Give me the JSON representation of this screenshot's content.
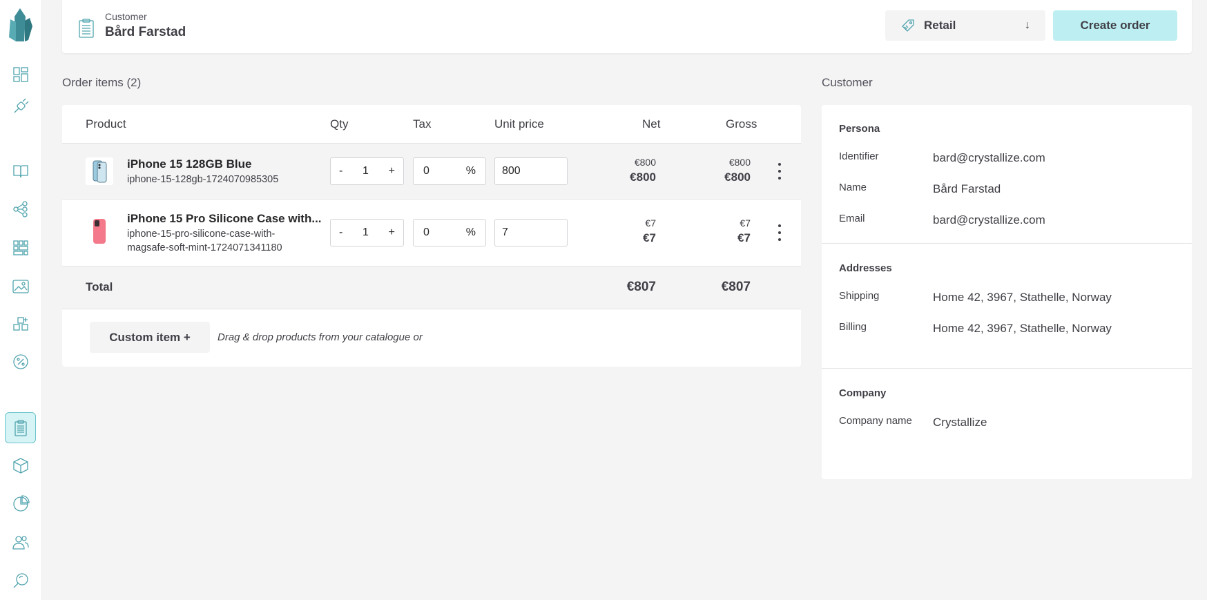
{
  "header": {
    "customer_label": "Customer",
    "customer_name": "Bård Farstad",
    "price_list": "Retail",
    "create_order": "Create order"
  },
  "order_items": {
    "title": "Order items (2)",
    "columns": [
      "Product",
      "Qty",
      "Tax",
      "Unit price",
      "Net",
      "Gross"
    ],
    "items": [
      {
        "name": "iPhone 15 128GB Blue",
        "sku": "iphone-15-128gb-1724070985305",
        "qty": "1",
        "tax": "0",
        "tax_unit": "%",
        "unit_price": "800",
        "net_small": "€800",
        "net_big": "€800",
        "gross_small": "€800",
        "gross_big": "€800"
      },
      {
        "name": "iPhone 15 Pro Silicone Case with...",
        "sku_line1": "iphone-15-pro-silicone-case-with-",
        "sku_line2": "magsafe-soft-mint-1724071341180",
        "qty": "1",
        "tax": "0",
        "tax_unit": "%",
        "unit_price": "7",
        "net_small": "€7",
        "net_big": "€7",
        "gross_small": "€7",
        "gross_big": "€7"
      }
    ],
    "total_label": "Total",
    "total_net": "€807",
    "total_gross": "€807",
    "qty_minus": "-",
    "qty_plus": "+",
    "custom_item": "Custom item +",
    "drag_hint": "Drag & drop products from your catalogue or"
  },
  "customer": {
    "title": "Customer",
    "persona": {
      "title": "Persona",
      "identifier_label": "Identifier",
      "identifier": "bard@crystallize.com",
      "name_label": "Name",
      "name": "Bård Farstad",
      "email_label": "Email",
      "email": "bard@crystallize.com"
    },
    "addresses": {
      "title": "Addresses",
      "shipping_label": "Shipping",
      "shipping": "Home 42, 3967, Stathelle, Norway",
      "billing_label": "Billing",
      "billing": "Home 42, 3967, Stathelle, Norway"
    },
    "company": {
      "title": "Company",
      "company_name_label": "Company name",
      "company_name": "Crystallize"
    }
  },
  "colors": {
    "accent": "#4fa3ad",
    "create_button": "#bdeff2",
    "active_nav": "#d6f3f5"
  },
  "sidebar_icons": [
    "dashboard-icon",
    "plug-icon",
    "book-icon",
    "graph-icon",
    "grid-icon",
    "image-icon",
    "shapes-icon",
    "discount-icon",
    "orders-icon",
    "box-icon",
    "pie-chart-icon",
    "users-icon",
    "search-icon"
  ]
}
